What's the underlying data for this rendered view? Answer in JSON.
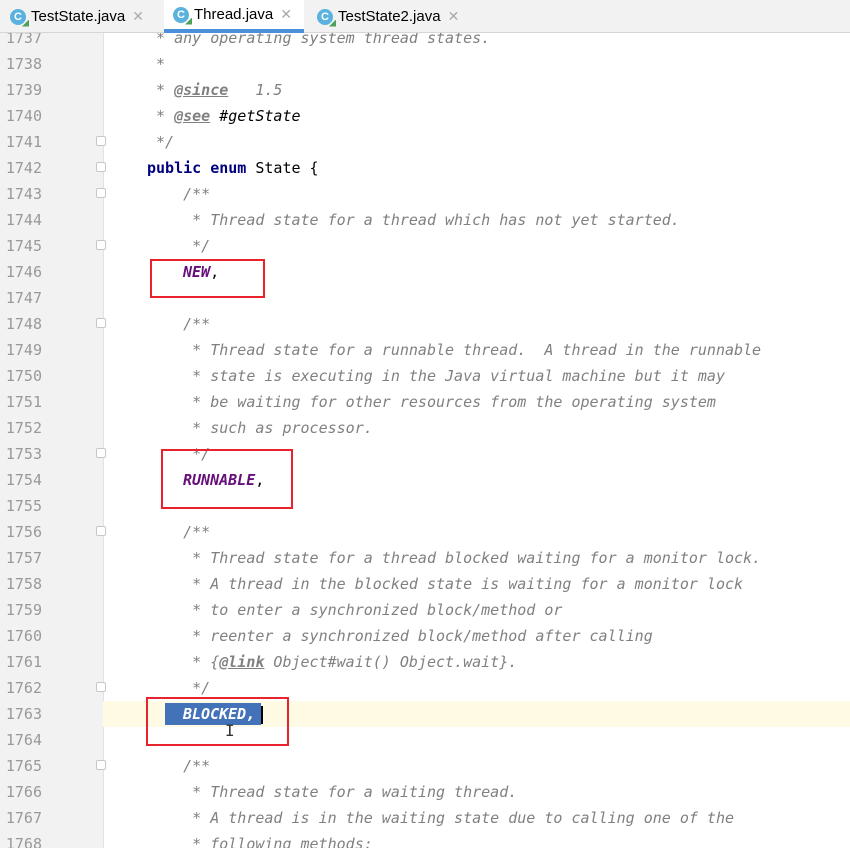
{
  "tabs": [
    {
      "label": "TestState.java",
      "active": false,
      "icon": "class-icon"
    },
    {
      "label": "Thread.java",
      "active": true,
      "icon": "class-icon"
    },
    {
      "label": "TestState2.java",
      "active": false,
      "icon": "class-icon"
    }
  ],
  "tab_icon_letter": "C",
  "close_glyph": "✕",
  "editor": {
    "line_numbers": [
      "1737",
      "1738",
      "1739",
      "1740",
      "1741",
      "1742",
      "1743",
      "1744",
      "1745",
      "1746",
      "1747",
      "1748",
      "1749",
      "1750",
      "1751",
      "1752",
      "1753",
      "1754",
      "1755",
      "1756",
      "1757",
      "1758",
      "1759",
      "1760",
      "1761",
      "1762",
      "1763",
      "1764",
      "1765",
      "1766",
      "1767",
      "1768"
    ],
    "code": {
      "l1737": " * any operating system thread states.",
      "l1738": " *",
      "l1739_star": " * ",
      "l1739_tag": "@since",
      "l1739_rest": "   1.5",
      "l1740_star": " * ",
      "l1740_tag": "@see",
      "l1740_rest": " #getState",
      "l1741": " */",
      "l1742_kw": "public enum",
      "l1742_rest": " State {",
      "l1743": "    /**",
      "l1744": "     * Thread state for a thread which has not yet started.",
      "l1745": "     */",
      "l1746_enum": "NEW",
      "l1746_rest": ",",
      "l1748": "    /**",
      "l1749": "     * Thread state for a runnable thread.  A thread in the runnable",
      "l1750": "     * state is executing in the Java virtual machine but it may",
      "l1751": "     * be waiting for other resources from the operating system",
      "l1752": "     * such as processor.",
      "l1753": "     */",
      "l1754_enum": "RUNNABLE",
      "l1754_rest": ",",
      "l1756": "    /**",
      "l1757": "     * Thread state for a thread blocked waiting for a monitor lock.",
      "l1758": "     * A thread in the blocked state is waiting for a monitor lock",
      "l1759": "     * to enter a synchronized block/method or",
      "l1760": "     * reenter a synchronized block/method after calling",
      "l1761_a": "     * {",
      "l1761_tag": "@link",
      "l1761_b": " Object#wait() Object.wait}.",
      "l1762": "     */",
      "l1763_sel": "BLOCKED,",
      "l1765": "    /**",
      "l1766": "     * Thread state for a waiting thread.",
      "l1767": "     * A thread is in the waiting state due to calling one of the",
      "l1768": "     * following methods:"
    }
  },
  "mouse_cursor_glyph": "I",
  "colors": {
    "annotation_box": "#e8232c",
    "selection": "#4472b8",
    "enum_constant": "#660e7a",
    "keyword": "#000080",
    "comment": "#808080",
    "caret_line": "#fffae3"
  }
}
